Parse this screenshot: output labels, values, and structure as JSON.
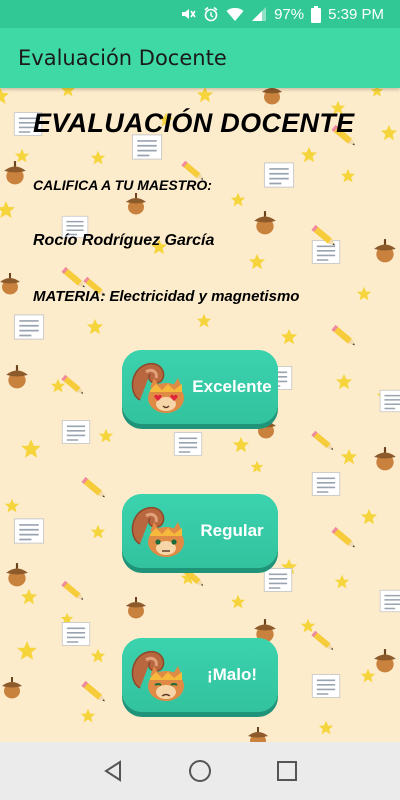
{
  "status_bar": {
    "battery": "97%",
    "time": "5:39 PM",
    "icons": [
      "mute-icon",
      "alarm-icon",
      "wifi-icon",
      "signal-icon",
      "battery-icon"
    ]
  },
  "app_bar": {
    "title": "Evaluación Docente"
  },
  "main": {
    "heading": "EVALUACIÓN DOCENTE",
    "subtitle": "CALIFICA A TU MAESTRO:",
    "teacher_name": "Rocío Rodríguez García",
    "subject": "MATERIA: Electricidad y magnetismo"
  },
  "rating_buttons": [
    {
      "label": "Excelente",
      "icon": "squirrel-heart-eyes-icon"
    },
    {
      "label": "Regular",
      "icon": "squirrel-neutral-icon"
    },
    {
      "label": "¡Malo!",
      "icon": "squirrel-sad-icon"
    }
  ],
  "nav_bar": {
    "buttons": [
      "back-icon",
      "home-icon",
      "recents-icon"
    ]
  },
  "colors": {
    "status_bar": "#31c896",
    "app_bar": "#3fd9a6",
    "background": "#fdeccb",
    "button": "#36c8a4",
    "star": "#f5d43c",
    "acorn": "#c9823e"
  }
}
